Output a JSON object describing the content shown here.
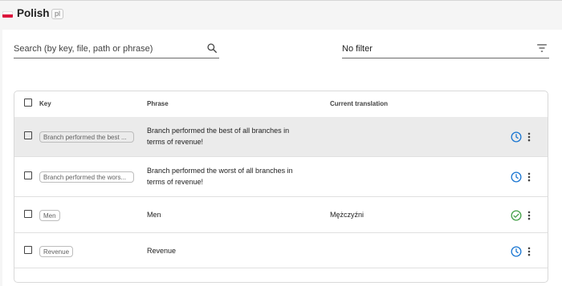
{
  "header": {
    "language_name": "Polish",
    "language_code": "pl"
  },
  "search": {
    "placeholder": "Search (by key, file, path or phrase)"
  },
  "filter": {
    "value": "No filter"
  },
  "table": {
    "columns": {
      "key": "Key",
      "phrase": "Phrase",
      "translation": "Current translation"
    },
    "rows": [
      {
        "key": "Branch performed the best ...",
        "phrase": "Branch performed the best of all branches in terms of revenue!",
        "translation": "",
        "status": "clock-icon",
        "selected": true
      },
      {
        "key": "Branch performed the wors...",
        "phrase": "Branch performed the worst of all branches in terms of revenue!",
        "translation": "",
        "status": "clock-icon",
        "selected": false
      },
      {
        "key": "Men",
        "phrase": "Men",
        "translation": "Mężczyźni",
        "status": "check-circle-icon",
        "selected": false
      },
      {
        "key": "Revenue",
        "phrase": "Revenue",
        "translation": "",
        "status": "clock-icon",
        "selected": false
      }
    ]
  },
  "colors": {
    "accent_blue": "#1976d2",
    "success_green": "#43a047",
    "flag_red": "#dc143c"
  }
}
